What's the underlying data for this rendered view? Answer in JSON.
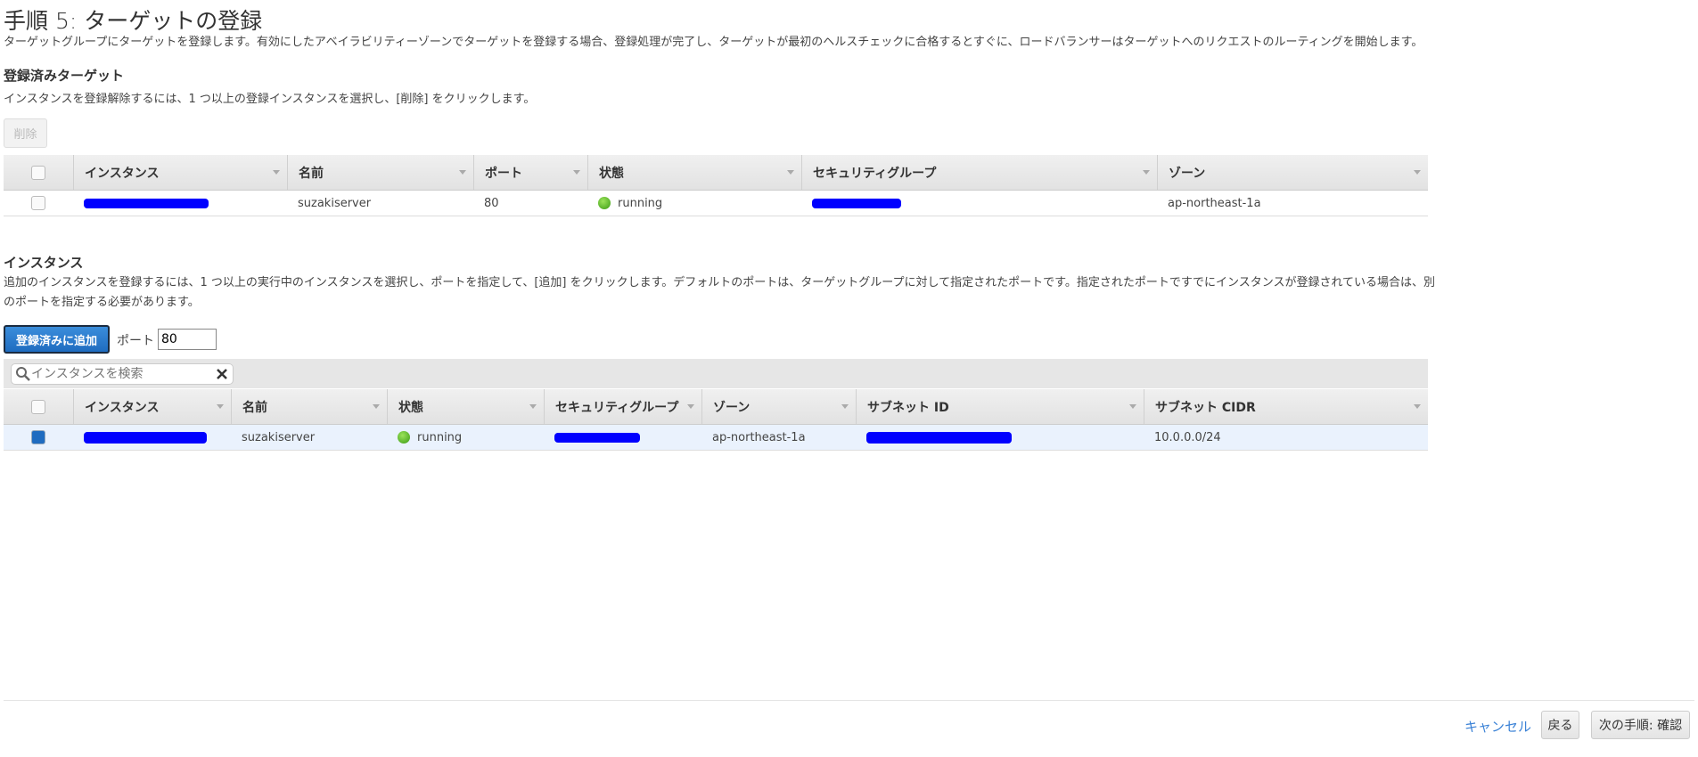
{
  "header": {
    "title": "手順 5: ターゲットの登録",
    "description": "ターゲットグループにターゲットを登録します。有効にしたアベイラビリティーゾーンでターゲットを登録する場合、登録処理が完了し、ターゲットが最初のヘルスチェックに合格するとすぐに、ロードバランサーはターゲットへのリクエストのルーティングを開始します。"
  },
  "registered": {
    "heading": "登録済みターゲット",
    "description": "インスタンスを登録解除するには、1 つ以上の登録インスタンスを選択し、[削除] をクリックします。",
    "remove_label": "削除",
    "columns": [
      "インスタンス",
      "名前",
      "ポート",
      "状態",
      "セキュリティグループ",
      "ゾーン"
    ],
    "rows": [
      {
        "name": "suzakiserver",
        "port": "80",
        "state": "running",
        "zone": "ap-northeast-1a"
      }
    ]
  },
  "instances": {
    "heading": "インスタンス",
    "description": "追加のインスタンスを登録するには、1 つ以上の実行中のインスタンスを選択し、ポートを指定して、[追加] をクリックします。デフォルトのポートは、ターゲットグループに対して指定されたポートです。指定されたポートですでにインスタンスが登録されている場合は、別のポートを指定する必要があります。",
    "add_label": "登録済みに追加",
    "port_label": "ポート",
    "port_value": "80",
    "search_placeholder": "インスタンスを検索",
    "columns": [
      "インスタンス",
      "名前",
      "状態",
      "セキュリティグループ",
      "ゾーン",
      "サブネット ID",
      "サブネット CIDR"
    ],
    "rows": [
      {
        "name": "suzakiserver",
        "state": "running",
        "zone": "ap-northeast-1a",
        "cidr": "10.0.0.0/24",
        "selected": true
      }
    ]
  },
  "footer": {
    "cancel": "キャンセル",
    "back": "戻る",
    "next": "次の手順: 確認"
  },
  "colors": {
    "primary": "#1f6cc0",
    "link": "#3b82d6",
    "redaction": "#0000ff"
  }
}
